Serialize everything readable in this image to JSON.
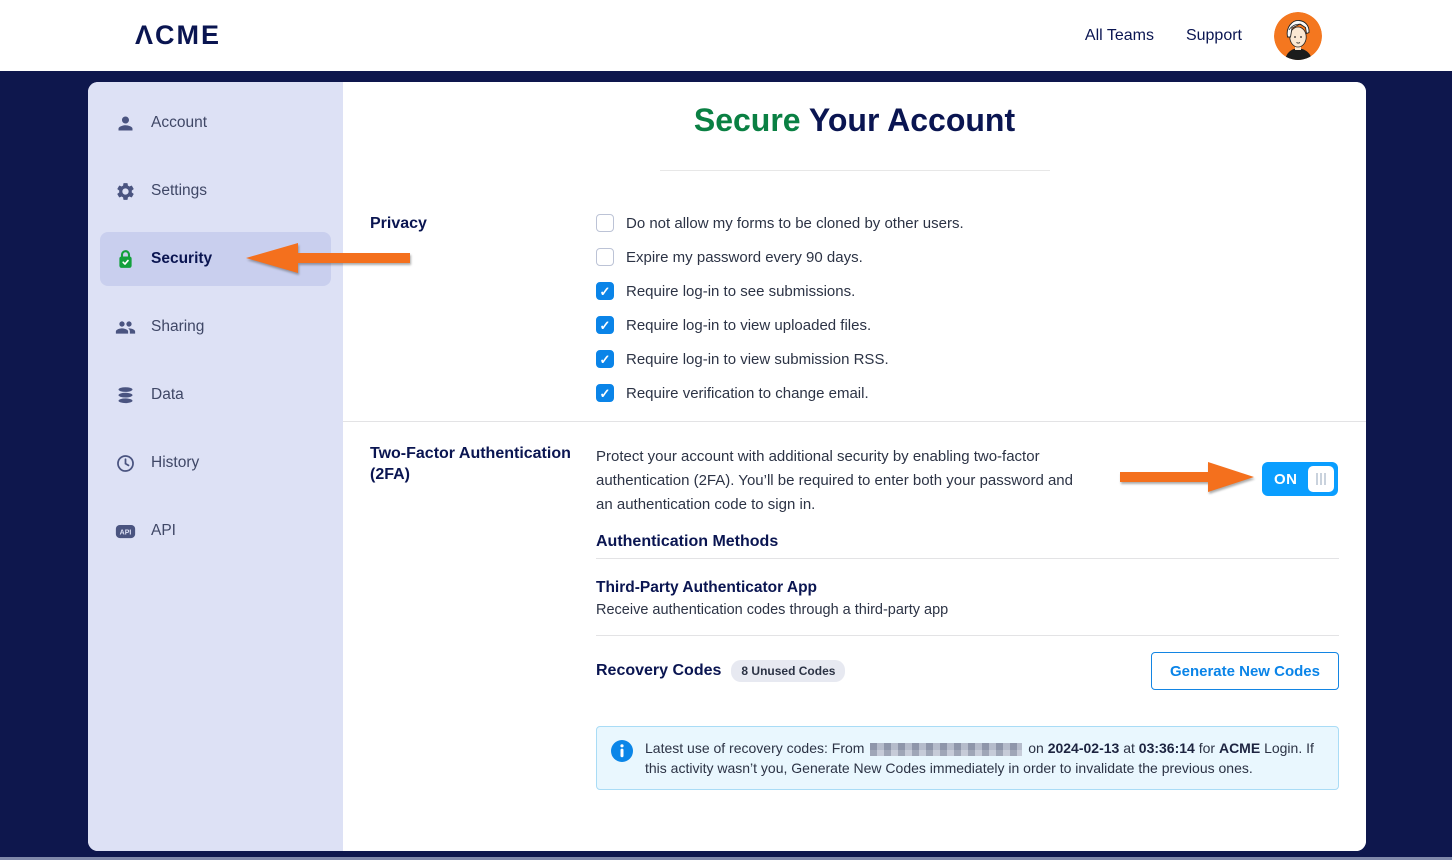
{
  "colors": {
    "brand_navy": "#0a1551",
    "page_background": "#0e174d",
    "sidebar_background": "#dde1f5",
    "sidebar_active_background": "#c9cfee",
    "title_green": "#0a8043",
    "security_icon_green": "#12a03c",
    "checkbox_blue": "#0a84e8",
    "toggle_blue": "#0a9eff",
    "button_blue": "#0a84e8",
    "arrow_orange": "#f4701d",
    "notice_background": "#e9f7fe",
    "notice_border": "#a9dcf6"
  },
  "header": {
    "logo_text": "ΛCME",
    "nav": {
      "all_teams": "All Teams",
      "support": "Support"
    }
  },
  "sidebar": {
    "items": [
      {
        "label": "Account",
        "icon": "user-icon",
        "active": false
      },
      {
        "label": "Settings",
        "icon": "gear-icon",
        "active": false
      },
      {
        "label": "Security",
        "icon": "lock-icon",
        "active": true
      },
      {
        "label": "Sharing",
        "icon": "people-icon",
        "active": false
      },
      {
        "label": "Data",
        "icon": "database-icon",
        "active": false
      },
      {
        "label": "History",
        "icon": "clock-icon",
        "active": false
      },
      {
        "label": "API",
        "icon": "api-icon",
        "active": false
      }
    ],
    "api_icon_text": "API"
  },
  "main": {
    "title": {
      "highlight": "Secure",
      "rest": "Your Account"
    },
    "privacy": {
      "label": "Privacy",
      "options": [
        {
          "label": "Do not allow my forms to be cloned by other users.",
          "checked": false
        },
        {
          "label": "Expire my password every 90 days.",
          "checked": false
        },
        {
          "label": "Require log-in to see submissions.",
          "checked": true
        },
        {
          "label": "Require log-in to view uploaded files.",
          "checked": true
        },
        {
          "label": "Require log-in to view submission RSS.",
          "checked": true
        },
        {
          "label": "Require verification to change email.",
          "checked": true
        }
      ]
    },
    "twofa": {
      "label_line1": "Two-Factor Authentication",
      "label_line2": "(2FA)",
      "description": "Protect your account with additional security by enabling two-factor authentication (2FA). You’ll be required to enter both your password and an authentication code to sign in.",
      "toggle_label": "ON",
      "methods_heading": "Authentication Methods",
      "method": {
        "title": "Third-Party Authenticator App",
        "description": "Receive authentication codes through a third-party app"
      },
      "recovery": {
        "label": "Recovery Codes",
        "badge": "8 Unused Codes",
        "button_label": "Generate New Codes"
      },
      "notice": {
        "prefix": "Latest use of recovery codes: From ",
        "on": " on ",
        "date": "2024-02-13",
        "at": " at ",
        "time": "03:36:14",
        "for": " for ",
        "brand": "ACME",
        "suffix": " Login. If this activity wasn’t you, Generate New Codes immediately in order to invalidate the previous ones."
      }
    }
  }
}
